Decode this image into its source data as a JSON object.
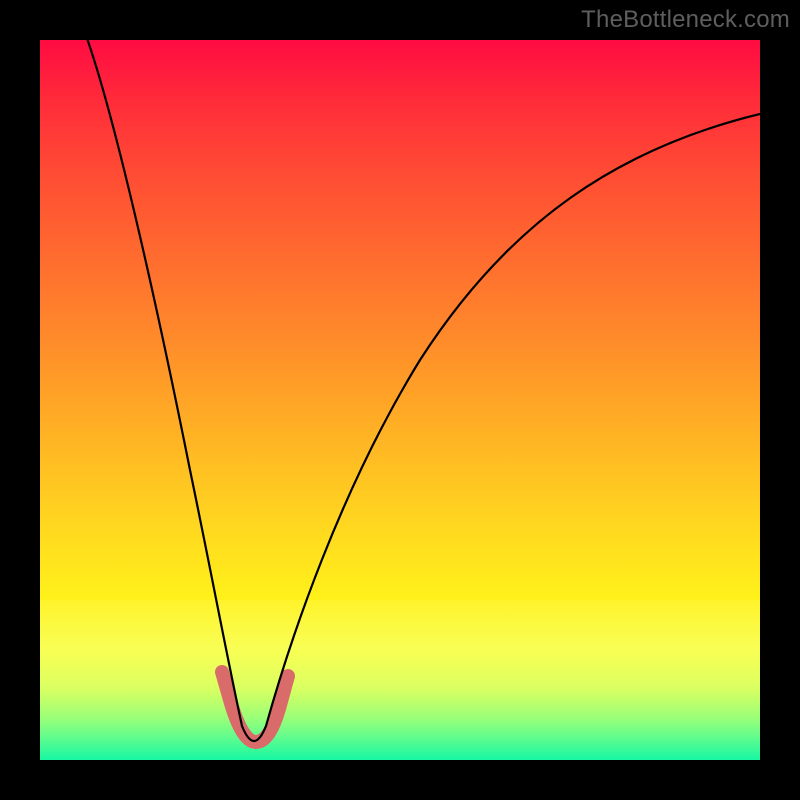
{
  "watermark": "TheBottleneck.com",
  "colors": {
    "frame": "#000000",
    "curve": "#000000",
    "valley_marker": "#d96b6b",
    "gradient_top": "#ff0b42",
    "gradient_bottom": "#16f7a3"
  },
  "chart_data": {
    "type": "line",
    "title": "",
    "xlabel": "",
    "ylabel": "",
    "xlim": [
      0,
      100
    ],
    "ylim": [
      0,
      100
    ],
    "grid": false,
    "series": [
      {
        "name": "bottleneck-curve",
        "x": [
          5,
          8,
          11,
          14,
          17,
          20,
          22,
          24,
          26,
          27,
          28,
          30,
          32,
          34,
          36,
          40,
          46,
          54,
          62,
          70,
          78,
          86,
          94,
          100
        ],
        "y": [
          100,
          88,
          75,
          62,
          49,
          36,
          26,
          17,
          9,
          4,
          1,
          1,
          4,
          9,
          15,
          26,
          40,
          54,
          65,
          73,
          79,
          83,
          86,
          88
        ]
      }
    ],
    "annotations": [
      {
        "name": "valley-highlight",
        "x_range": [
          25,
          34
        ],
        "y_range": [
          0,
          12
        ],
        "color": "#d96b6b"
      }
    ]
  }
}
